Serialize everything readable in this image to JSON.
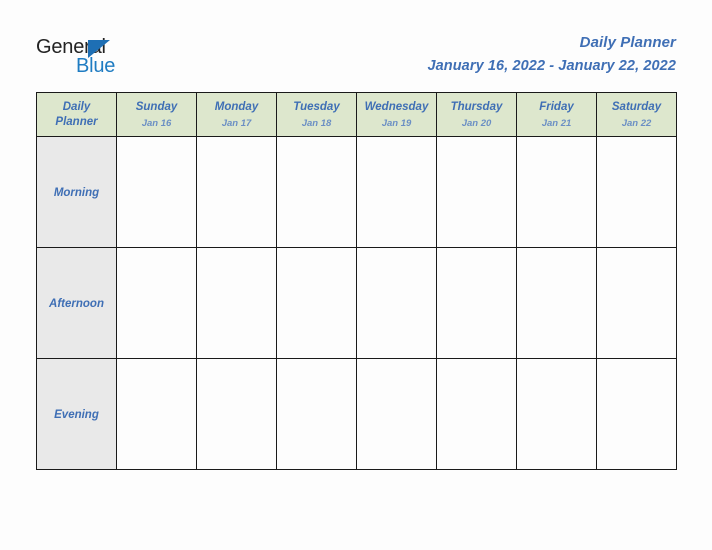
{
  "document": {
    "title": "Daily Planner",
    "date_range": "January 16, 2022 - January 22, 2022"
  },
  "logo": {
    "word_one": "General",
    "word_two": "Blue",
    "triangle_icon": "blue-triangle-icon",
    "colors": {
      "word_one": "#232323",
      "word_two": "#1f7cc2",
      "triangle": "#1e6fb4"
    }
  },
  "colors": {
    "accent_blue": "#3f6fb5",
    "date_blue": "#6b8fc4",
    "header_green": "#dde7cd",
    "row_label_gray": "#e9e9e9",
    "border": "#1a1a1a",
    "page_background": "#fdfdfd"
  },
  "table": {
    "corner_label_line1": "Daily",
    "corner_label_line2": "Planner",
    "columns": [
      {
        "day": "Sunday",
        "date": "Jan 16"
      },
      {
        "day": "Monday",
        "date": "Jan 17"
      },
      {
        "day": "Tuesday",
        "date": "Jan 18"
      },
      {
        "day": "Wednesday",
        "date": "Jan 19"
      },
      {
        "day": "Thursday",
        "date": "Jan 20"
      },
      {
        "day": "Friday",
        "date": "Jan 21"
      },
      {
        "day": "Saturday",
        "date": "Jan 22"
      }
    ],
    "rows": [
      {
        "label": "Morning",
        "cells": [
          "",
          "",
          "",
          "",
          "",
          "",
          ""
        ]
      },
      {
        "label": "Afternoon",
        "cells": [
          "",
          "",
          "",
          "",
          "",
          "",
          ""
        ]
      },
      {
        "label": "Evening",
        "cells": [
          "",
          "",
          "",
          "",
          "",
          "",
          ""
        ]
      }
    ]
  }
}
